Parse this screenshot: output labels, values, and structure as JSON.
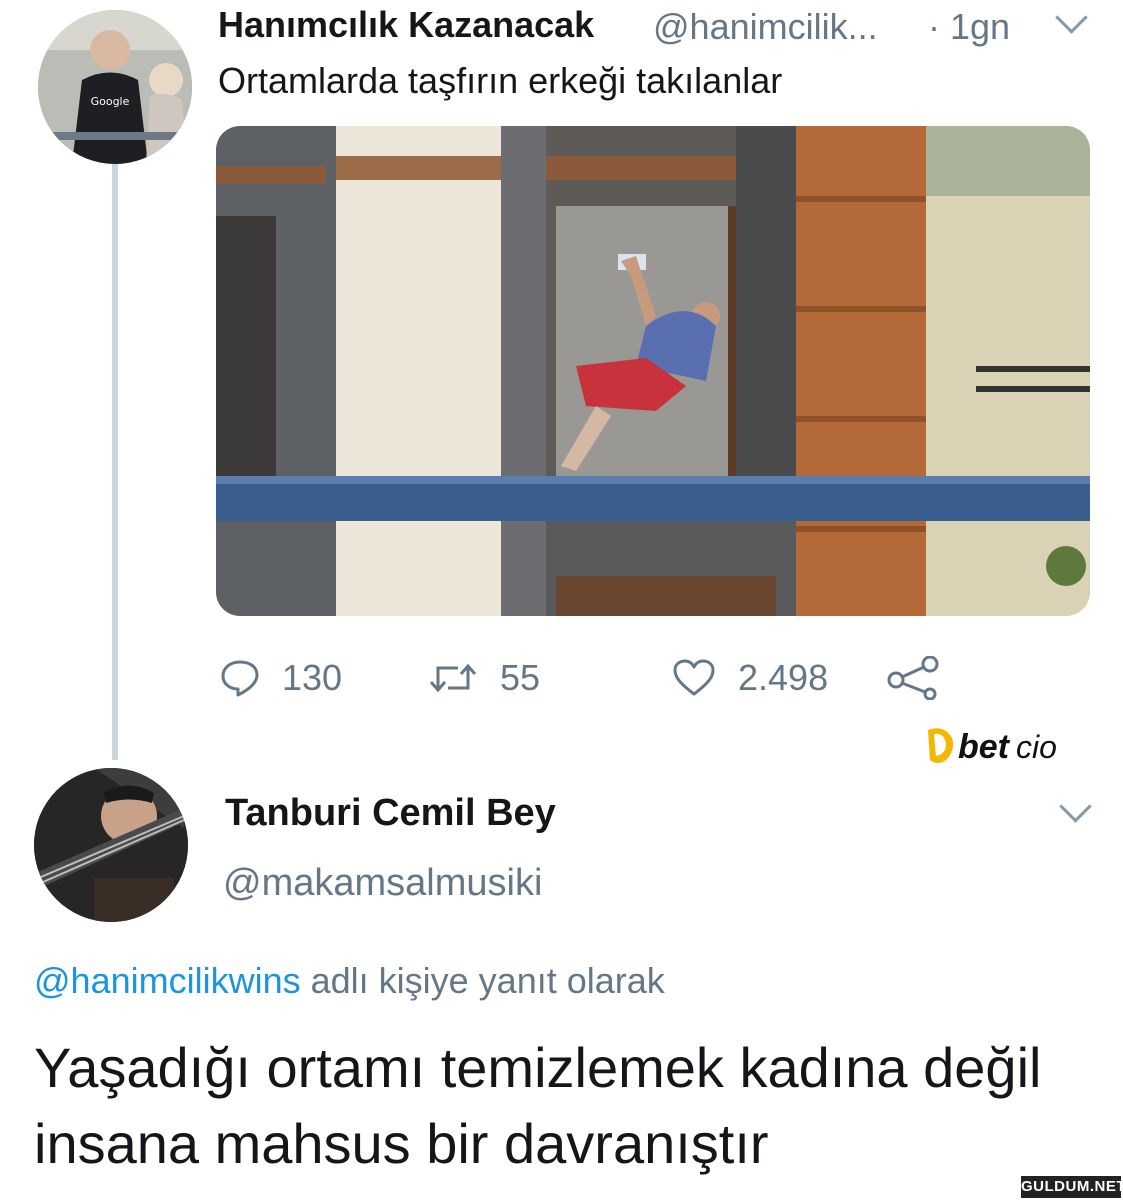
{
  "tweet": {
    "name": "Hanımcılık Kazanacak",
    "handle": "@hanimcilik...",
    "time": "· 1gn",
    "text": "Ortamlarda taşfırın erkeği takılanlar",
    "actions": {
      "replies": "130",
      "retweets": "55",
      "likes": "2.498"
    },
    "avatar_icon": "avatar-photo-icon",
    "menu_icon": "chevron-down-icon"
  },
  "reply": {
    "name": "Tanburi Cemil Bey",
    "handle": "@makamsalmusiki",
    "reply_prefix_mention": "@hanimcilikwins",
    "reply_prefix_rest": " adlı kişiye yanıt olarak",
    "text": "Yaşadığı ortamı temizlemek kadına değil insana mahsus bir davranıştır"
  },
  "overlay": {
    "logo_text_bold": "bet",
    "logo_text_light": "cio",
    "watermark": "GULDUM.NET"
  },
  "colors": {
    "link": "#1b95e0",
    "secondary": "#657786",
    "thread": "#ccd6dd",
    "logo_accent": "#f5b800"
  }
}
